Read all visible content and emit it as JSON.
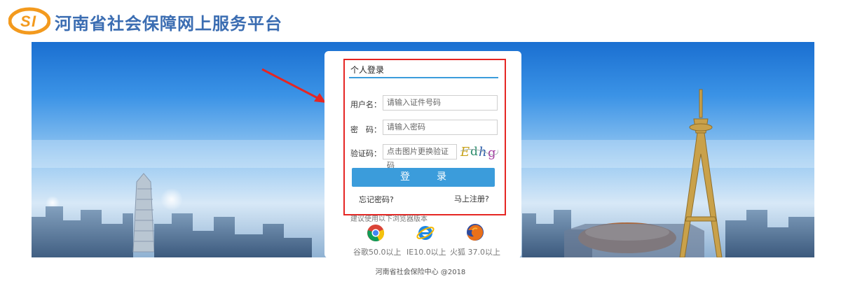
{
  "header": {
    "logo_text": "SI",
    "title": "河南省社会保障网上服务平台"
  },
  "login": {
    "tab_title": "个人登录",
    "username_label": "用户名：",
    "username_placeholder": "请输入证件号码",
    "password_label": "密　码：",
    "password_placeholder": "请输入密码",
    "captcha_label": "验证码：",
    "captcha_placeholder": "点击图片更换验证码",
    "captcha_text": "Edhg",
    "submit_label": "登录",
    "forgot_link": "忘记密码?",
    "register_link": "马上注册?"
  },
  "browsers": {
    "hint": "建议使用以下浏览器版本",
    "items": [
      {
        "label": "谷歌50.0以上",
        "icon": "chrome-icon"
      },
      {
        "label": "IE10.0以上",
        "icon": "ie-icon"
      },
      {
        "label": "火狐 37.0以上",
        "icon": "firefox-icon"
      }
    ]
  },
  "footer": {
    "copyright": "河南省社会保险中心 @2018"
  },
  "colors": {
    "accent": "#3b9cdb",
    "title_blue": "#3b6db2",
    "logo_orange": "#f39a1e",
    "highlight_red": "#e52623"
  }
}
